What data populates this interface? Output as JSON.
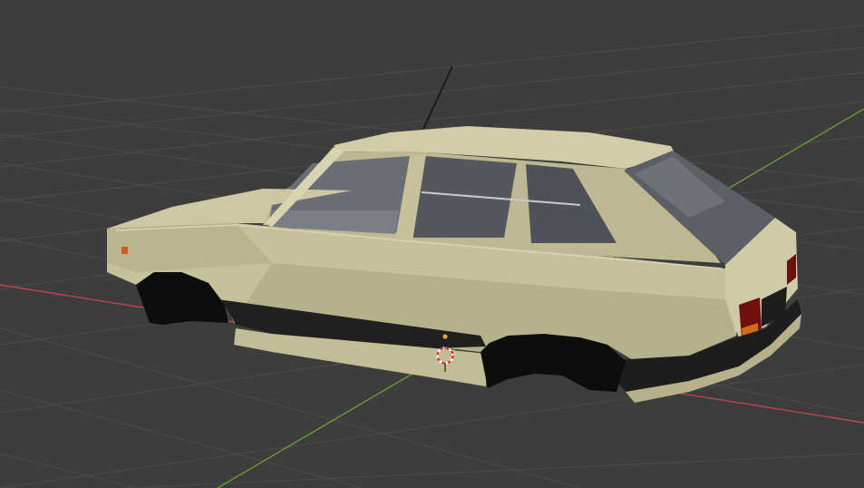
{
  "viewport": {
    "background": "#3d3d3d",
    "grid_color": "#4a4a4a",
    "x_axis_color": "#c0444c",
    "y_axis_color": "#6a9a34"
  },
  "model": {
    "body_color": "#c6c19a",
    "body_shadow": "#a7a37f",
    "body_highlight": "#d8d4b1",
    "trim_color": "#1c1d1c",
    "glass_color": "#5b5f66",
    "tail_light_color": "#6e1010"
  },
  "gizmo": {
    "origin_color": "#e8a533",
    "cursor_ring_color": "#e0241e"
  }
}
